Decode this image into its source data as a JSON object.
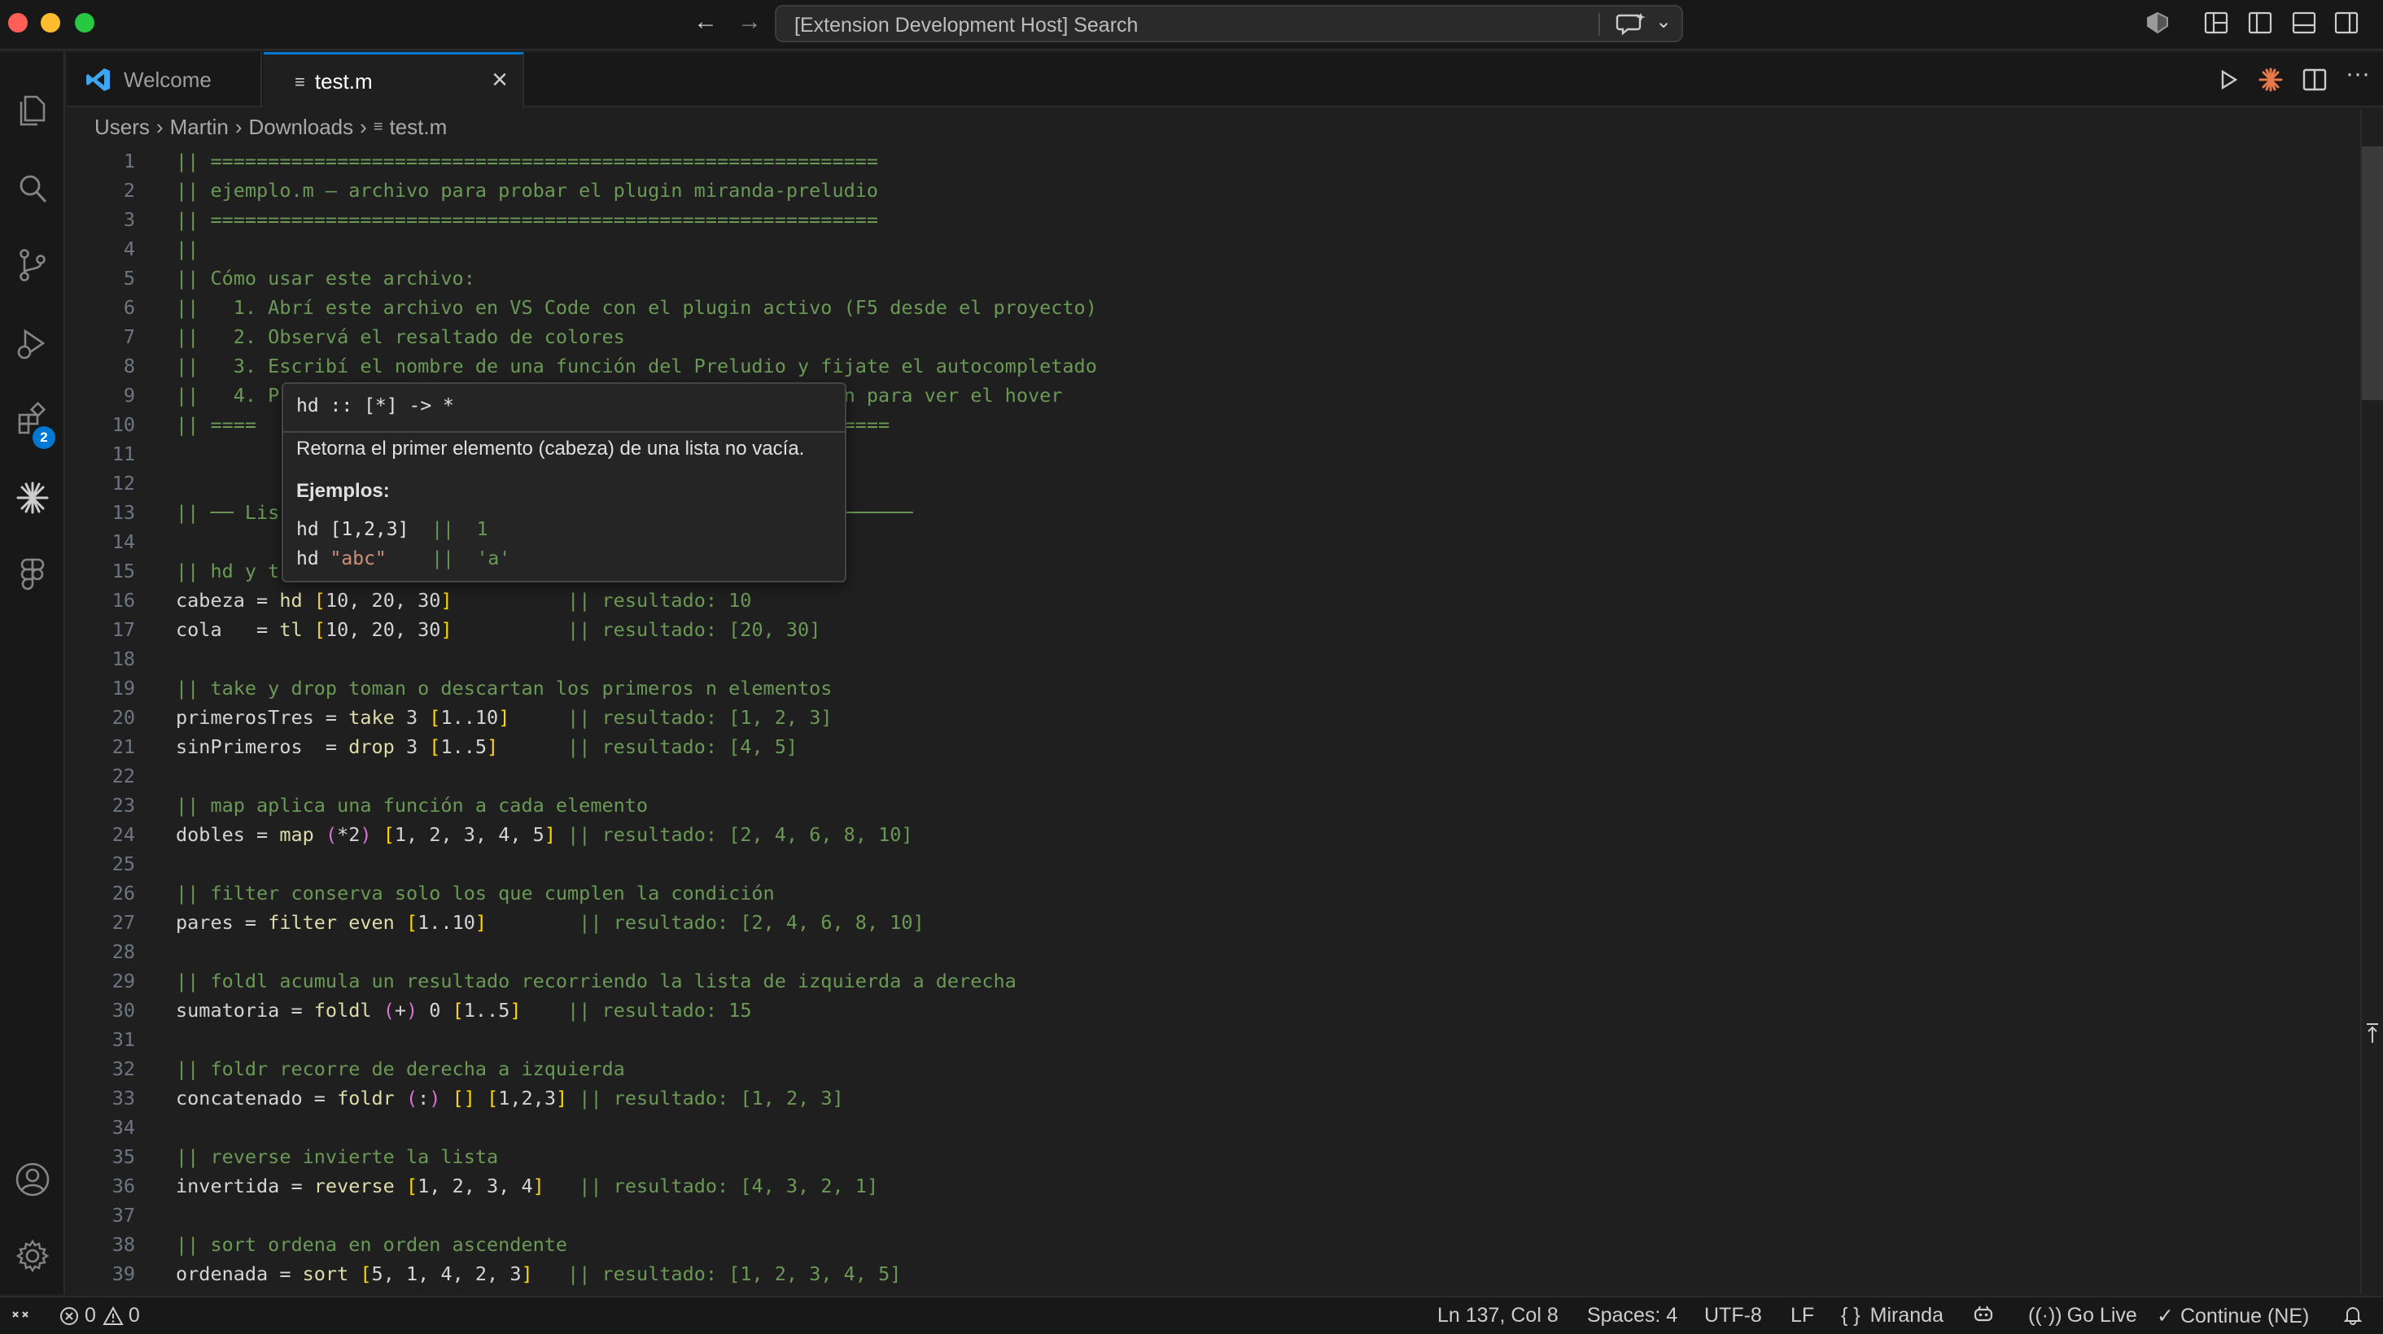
{
  "window": {
    "command_center_text": "[Extension Development Host] Search"
  },
  "activity_bar": {
    "extensions_badge": "2"
  },
  "tabs": [
    {
      "label": "Welcome",
      "active": false
    },
    {
      "label": "test.m",
      "active": true
    }
  ],
  "breadcrumb": [
    "Users",
    "Martin",
    "Downloads",
    "test.m"
  ],
  "editor": {
    "lines": [
      {
        "n": "1",
        "text": "|| =========================================================="
      },
      {
        "n": "2",
        "text": "|| ejemplo.m — archivo para probar el plugin miranda-preludio"
      },
      {
        "n": "3",
        "text": "|| =========================================================="
      },
      {
        "n": "4",
        "text": "||"
      },
      {
        "n": "5",
        "text": "|| Cómo usar este archivo:"
      },
      {
        "n": "6",
        "text": "||   1. Abrí este archivo en VS Code con el plugin activo (F5 desde el proyecto)"
      },
      {
        "n": "7",
        "text": "||   2. Observá el resaltado de colores"
      },
      {
        "n": "8",
        "text": "||   3. Escribí el nombre de una función del Preludio y fijate el autocompletado"
      },
      {
        "n": "9",
        "text": "||   4. P                                              ción para ver el hover"
      },
      {
        "n": "10",
        "text": "|| ====                                                  ====="
      },
      {
        "n": "11",
        "text": ""
      },
      {
        "n": "12",
        "text": ""
      },
      {
        "n": "13",
        "text": "|| ── Lis                                                 ──────"
      },
      {
        "n": "14",
        "text": ""
      },
      {
        "n": "15",
        "text": "|| hd y t"
      },
      {
        "n": "16",
        "text": "cabeza = hd [10, 20, 30]          || resultado: 10"
      },
      {
        "n": "17",
        "text": "cola   = tl [10, 20, 30]          || resultado: [20, 30]"
      },
      {
        "n": "18",
        "text": ""
      },
      {
        "n": "19",
        "text": "|| take y drop toman o descartan los primeros n elementos"
      },
      {
        "n": "20",
        "text": "primerosTres = take 3 [1..10]     || resultado: [1, 2, 3]"
      },
      {
        "n": "21",
        "text": "sinPrimeros  = drop 3 [1..5]      || resultado: [4, 5]"
      },
      {
        "n": "22",
        "text": ""
      },
      {
        "n": "23",
        "text": "|| map aplica una función a cada elemento"
      },
      {
        "n": "24",
        "text": "dobles = map (*2) [1, 2, 3, 4, 5] || resultado: [2, 4, 6, 8, 10]"
      },
      {
        "n": "25",
        "text": ""
      },
      {
        "n": "26",
        "text": "|| filter conserva solo los que cumplen la condición"
      },
      {
        "n": "27",
        "text": "pares = filter even [1..10]        || resultado: [2, 4, 6, 8, 10]"
      },
      {
        "n": "28",
        "text": ""
      },
      {
        "n": "29",
        "text": "|| foldl acumula un resultado recorriendo la lista de izquierda a derecha"
      },
      {
        "n": "30",
        "text": "sumatoria = foldl (+) 0 [1..5]    || resultado: 15"
      },
      {
        "n": "31",
        "text": ""
      },
      {
        "n": "32",
        "text": "|| foldr recorre de derecha a izquierda"
      },
      {
        "n": "33",
        "text": "concatenado = foldr (:) [] [1,2,3] || resultado: [1, 2, 3]"
      },
      {
        "n": "34",
        "text": ""
      },
      {
        "n": "35",
        "text": "|| reverse invierte la lista"
      },
      {
        "n": "36",
        "text": "invertida = reverse [1, 2, 3, 4]   || resultado: [4, 3, 2, 1]"
      },
      {
        "n": "37",
        "text": ""
      },
      {
        "n": "38",
        "text": "|| sort ordena en orden ascendente"
      },
      {
        "n": "39",
        "text": "ordenada = sort [5, 1, 4, 2, 3]   || resultado: [1, 2, 3, 4, 5]"
      }
    ]
  },
  "hover": {
    "signature": "hd :: [*] -> *",
    "description": "Retorna el primer elemento (cabeza) de una lista no vacía.",
    "examples_label": "Ejemplos:",
    "example1_code": "hd [1,2,3]",
    "example1_comment": "||  1",
    "example2_code": "hd ",
    "example2_string": "\"abc\"",
    "example2_comment": "||  'a'"
  },
  "status_bar": {
    "errors": "0",
    "warnings": "0",
    "cursor": "Ln 137, Col 8",
    "spaces": "Spaces: 4",
    "encoding": "UTF-8",
    "eol": "LF",
    "language_braces": "{ }",
    "language": "Miranda",
    "go_live": "Go Live",
    "continue": "Continue (NE)"
  },
  "colors": {
    "accent": "#0078d4",
    "comment": "#6a9955",
    "function": "#dcdcaa",
    "bracket": "#ffd700"
  }
}
